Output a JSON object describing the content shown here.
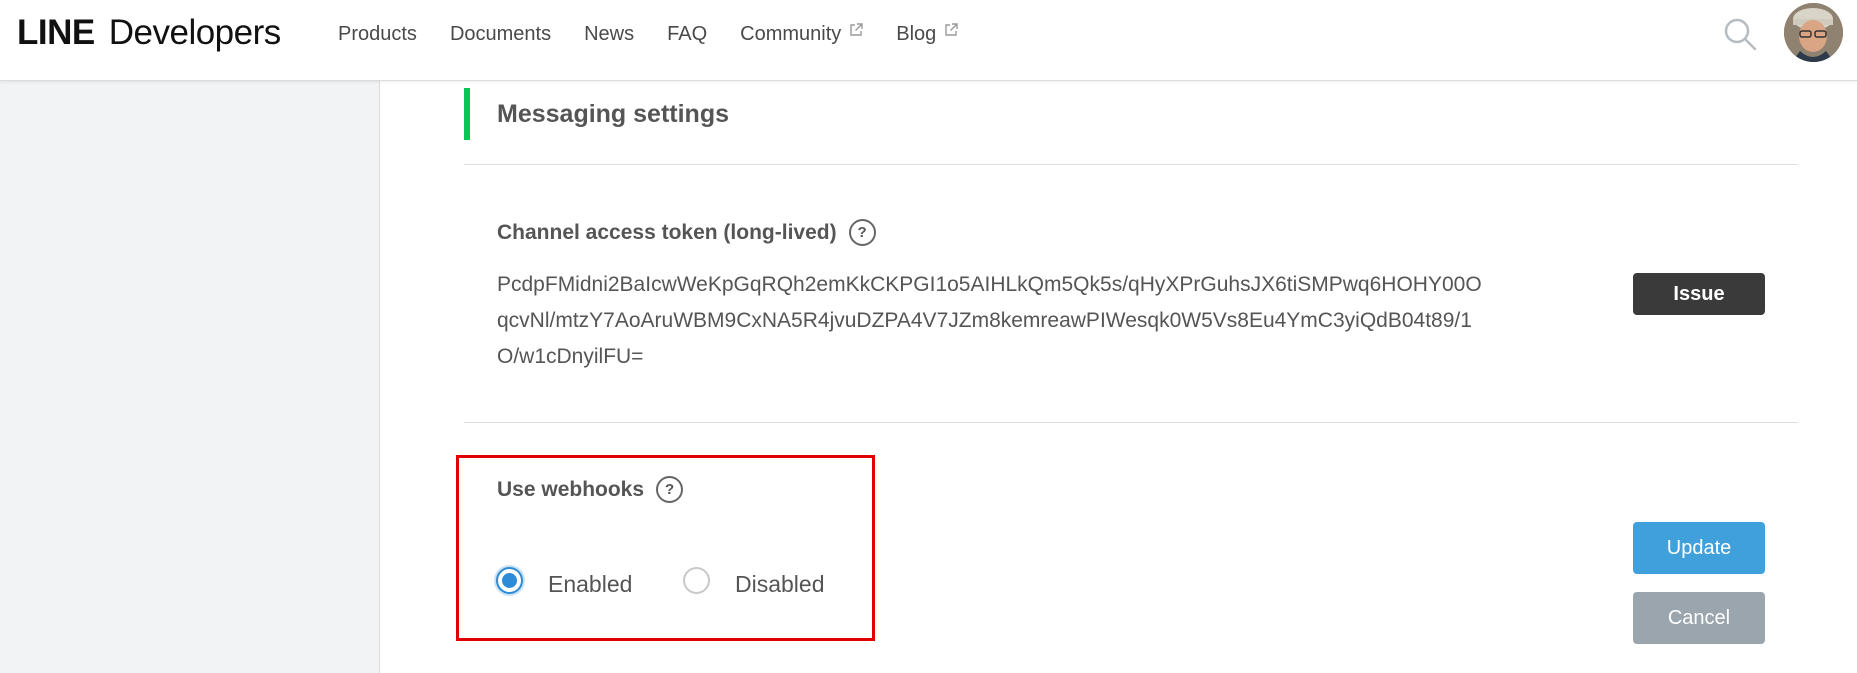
{
  "header": {
    "logo_line": "LINE",
    "logo_developers": "Developers",
    "nav": [
      {
        "label": "Products",
        "external": false
      },
      {
        "label": "Documents",
        "external": false
      },
      {
        "label": "News",
        "external": false
      },
      {
        "label": "FAQ",
        "external": false
      },
      {
        "label": "Community",
        "external": true
      },
      {
        "label": "Blog",
        "external": true
      }
    ]
  },
  "section": {
    "title": "Messaging settings",
    "accent_color": "#06c755"
  },
  "access_token": {
    "label": "Channel access token (long-lived)",
    "lines": [
      "PcdpFMidni2BaIcwWeKpGqRQh2emKkCKPGI1o5AIHLkQm5Qk5s/qHyXPrGuhsJX6tiSMPwq6HOHY00O",
      "qcvNl/mtzY7AoAruWBM9CxNA5R4jvuDZPA4V7JZm8kemreawPIWesqk0W5Vs8Eu4YmC3yiQdB04t89/1",
      "O/w1cDnyilFU="
    ],
    "issue_label": "Issue"
  },
  "webhooks": {
    "label": "Use webhooks",
    "options": [
      {
        "label": "Enabled",
        "checked": true
      },
      {
        "label": "Disabled",
        "checked": false
      }
    ],
    "update_label": "Update",
    "cancel_label": "Cancel"
  },
  "colors": {
    "update_button": "#3fa0db",
    "cancel_button": "#9aa5ae",
    "issue_button": "#3a3a3a",
    "highlight_border": "#e00000"
  }
}
